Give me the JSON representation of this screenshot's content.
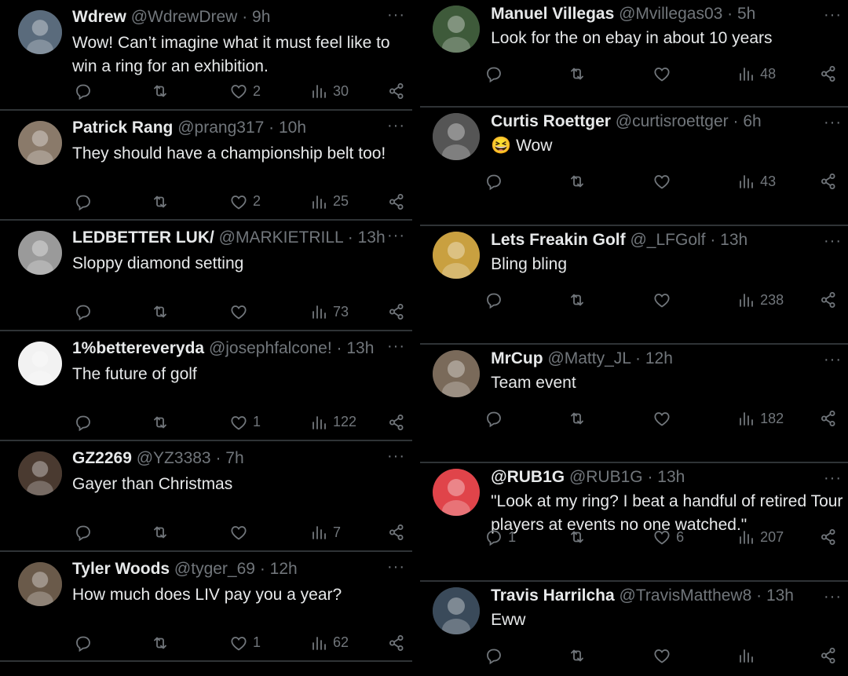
{
  "left_tweets": [
    {
      "name": "Wdrew",
      "handle": "@WdrewDrew",
      "time": "· 9h",
      "text": "Wow! Can’t imagine what it must feel like to win a ring for an exhibition.",
      "replies": "",
      "retweets": "",
      "likes": "2",
      "views": "30",
      "avatar_color": "#5a6b7c"
    },
    {
      "name": "Patrick Rang",
      "handle": "@prang317",
      "time": "· 10h",
      "text": "They should have a championship belt too!",
      "replies": "",
      "retweets": "",
      "likes": "2",
      "views": "25",
      "avatar_color": "#8a7a6a"
    },
    {
      "name": "LEDBETTER LUK/",
      "handle": "@MARKIETRILL",
      "time": "· 13h",
      "text": "Sloppy diamond setting",
      "replies": "",
      "retweets": "",
      "likes": "",
      "views": "73",
      "avatar_color": "#9a9a9a"
    },
    {
      "name": "1%bettereveryda",
      "handle": "@josephfalcone!",
      "time": "· 13h",
      "text": "The future of golf",
      "replies": "",
      "retweets": "",
      "likes": "1",
      "views": "122",
      "avatar_color": "#f2f2f2"
    },
    {
      "name": "GZ2269",
      "handle": "@YZ3383",
      "time": "· 7h",
      "text": "Gayer than Christmas",
      "replies": "",
      "retweets": "",
      "likes": "",
      "views": "7",
      "avatar_color": "#4a3a30"
    },
    {
      "name": "Tyler Woods",
      "handle": "@tyger_69",
      "time": "· 12h",
      "text": "How much does LIV pay you a year?",
      "replies": "",
      "retweets": "",
      "likes": "1",
      "views": "62",
      "avatar_color": "#6a5a4a"
    }
  ],
  "right_tweets": [
    {
      "name": "Manuel Villegas",
      "handle": "@Mvillegas03",
      "time": "· 5h",
      "text": "Look for the on ebay in about 10 years",
      "replies": "",
      "retweets": "",
      "likes": "",
      "views": "48",
      "avatar_color": "#3e5a3a"
    },
    {
      "name": "Curtis Roettger",
      "handle": "@curtisroettger",
      "time": "· 6h",
      "text": "😆 Wow",
      "replies": "",
      "retweets": "",
      "likes": "",
      "views": "43",
      "avatar_color": "#555555"
    },
    {
      "name": "Lets Freakin Golf",
      "handle": "@_LFGolf",
      "time": "· 13h",
      "text": "Bling bling",
      "replies": "",
      "retweets": "",
      "likes": "",
      "views": "238",
      "avatar_color": "#c9a040"
    },
    {
      "name": "MrCup",
      "handle": "@Matty_JL",
      "time": "· 12h",
      "text": "Team event",
      "replies": "",
      "retweets": "",
      "likes": "",
      "views": "182",
      "avatar_color": "#7a6a5a"
    },
    {
      "name": "@RUB1G",
      "handle": "@RUB1G",
      "time": "· 13h",
      "text": "\"Look at my ring? I beat a handful of retired Tour players at events no one watched.\"",
      "replies": "1",
      "retweets": "",
      "likes": "6",
      "views": "207",
      "avatar_color": "#e0444a"
    },
    {
      "name": "Travis Harrilcha",
      "handle": "@TravisMatthew8",
      "time": "· 13h",
      "text": "Eww",
      "replies": "",
      "retweets": "",
      "likes": "",
      "views": "",
      "avatar_color": "#3a4a5a"
    }
  ],
  "ui": {
    "more_glyph": "···"
  },
  "colors": {
    "bg": "#000000",
    "text": "#e7e9ea",
    "muted": "#71767b",
    "divider": "#2f3336"
  },
  "icons": [
    "reply-icon",
    "retweet-icon",
    "like-icon",
    "views-icon",
    "share-icon",
    "more-icon"
  ]
}
